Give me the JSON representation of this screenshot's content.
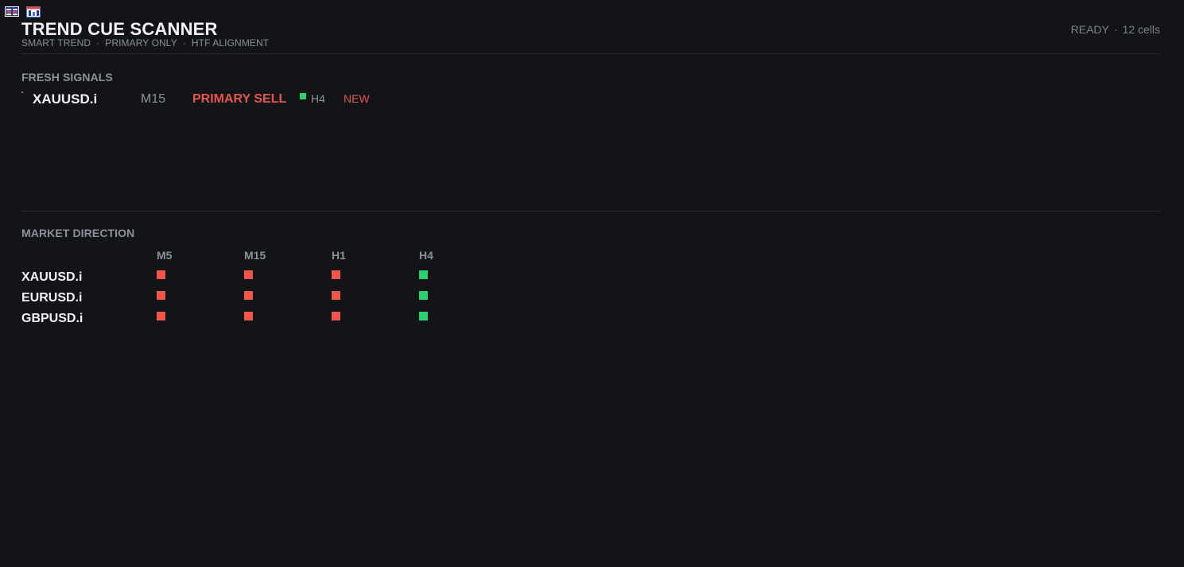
{
  "header": {
    "title": "TREND CUE SCANNER",
    "subtitle_parts": [
      "SMART TREND",
      "PRIMARY ONLY",
      "HTF ALIGNMENT"
    ],
    "separator": "·",
    "status": "READY",
    "cells": "12 cells"
  },
  "icons": [
    "table-icon",
    "chart-window-icon"
  ],
  "fresh_signals": {
    "title": "FRESH SIGNALS",
    "items": [
      {
        "symbol": "XAUUSD.i",
        "timeframe": "M15",
        "action": "PRIMARY SELL",
        "htf": "H4",
        "htf_direction": "bull",
        "tag": "NEW"
      }
    ]
  },
  "market_direction": {
    "title": "MARKET DIRECTION",
    "timeframes": [
      "M5",
      "M15",
      "H1",
      "H4"
    ],
    "rows": [
      {
        "symbol": "XAUUSD.i",
        "cells": [
          "bear",
          "bear",
          "bear",
          "bull"
        ]
      },
      {
        "symbol": "EURUSD.i",
        "cells": [
          "bear",
          "bear",
          "bear",
          "bull"
        ]
      },
      {
        "symbol": "GBPUSD.i",
        "cells": [
          "bear",
          "bear",
          "bear",
          "bull"
        ]
      }
    ]
  },
  "colors": {
    "background": "#131417",
    "bear": "#f0574a",
    "bull": "#2dcf6f",
    "sell_text": "#e5574c"
  }
}
